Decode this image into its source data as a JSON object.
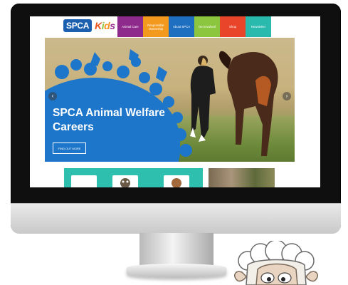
{
  "logo": {
    "spca": "SPCA",
    "kids_letters": [
      "K",
      "i",
      "d",
      "s"
    ]
  },
  "nav": [
    {
      "label": "Animal Care",
      "color": "#8e2a8b"
    },
    {
      "label": "Responsible Ownership",
      "color": "#f39a1e"
    },
    {
      "label": "About SPCA",
      "color": "#1f6fc0"
    },
    {
      "label": "Get Involved",
      "color": "#8cc63f"
    },
    {
      "label": "Shop",
      "color": "#e8452b"
    },
    {
      "label": "Newsletter",
      "color": "#29b9ad"
    }
  ],
  "hero": {
    "title": "SPCA Animal Welfare Careers",
    "button": "FIND OUT MORE",
    "prev_icon": "chevron-left-icon",
    "next_icon": "chevron-right-icon"
  },
  "colors": {
    "brand_blue": "#1d76c9",
    "teal": "#2fbfae"
  }
}
